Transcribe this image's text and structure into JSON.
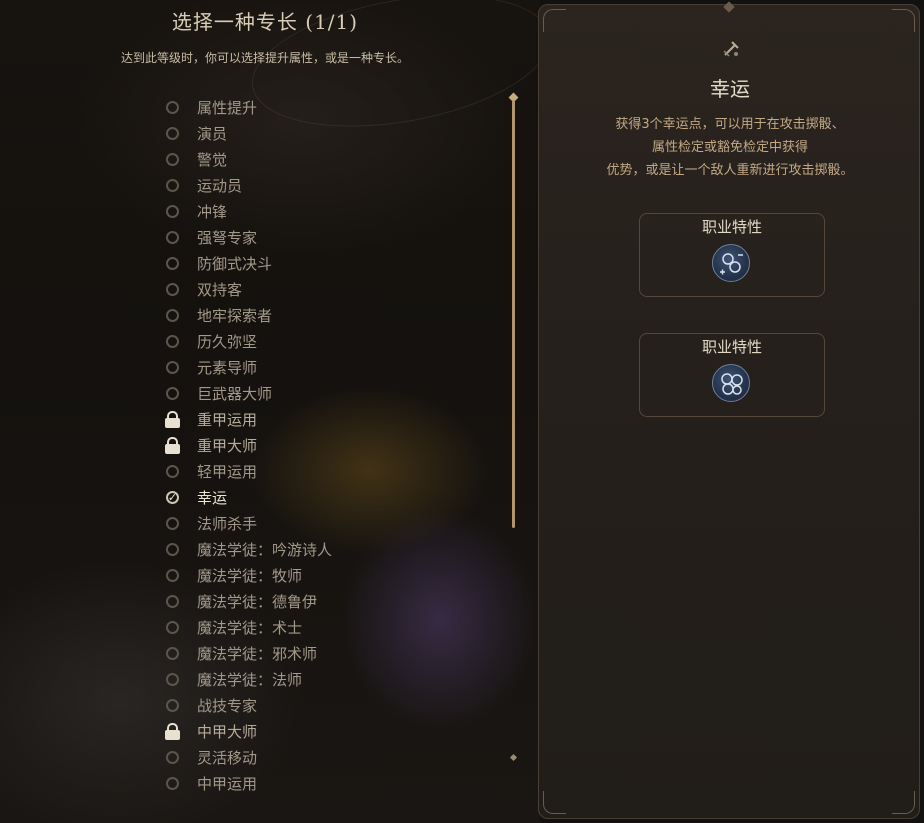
{
  "header": {
    "title": "选择一种专长 (1/1)",
    "subtitle": "达到此等级时，你可以选择提升属性，或是一种专长。"
  },
  "feat_list": [
    {
      "label": "属性提升",
      "state": "available"
    },
    {
      "label": "演员",
      "state": "available"
    },
    {
      "label": "警觉",
      "state": "available"
    },
    {
      "label": "运动员",
      "state": "available"
    },
    {
      "label": "冲锋",
      "state": "available"
    },
    {
      "label": "强弩专家",
      "state": "available"
    },
    {
      "label": "防御式决斗",
      "state": "available"
    },
    {
      "label": "双持客",
      "state": "available"
    },
    {
      "label": "地牢探索者",
      "state": "available"
    },
    {
      "label": "历久弥坚",
      "state": "available"
    },
    {
      "label": "元素导师",
      "state": "available"
    },
    {
      "label": "巨武器大师",
      "state": "available"
    },
    {
      "label": "重甲运用",
      "state": "locked"
    },
    {
      "label": "重甲大师",
      "state": "locked"
    },
    {
      "label": "轻甲运用",
      "state": "available"
    },
    {
      "label": "幸运",
      "state": "selected"
    },
    {
      "label": "法师杀手",
      "state": "available"
    },
    {
      "label": "魔法学徒：吟游诗人",
      "state": "available"
    },
    {
      "label": "魔法学徒：牧师",
      "state": "available"
    },
    {
      "label": "魔法学徒：德鲁伊",
      "state": "available"
    },
    {
      "label": "魔法学徒：术士",
      "state": "available"
    },
    {
      "label": "魔法学徒：邪术师",
      "state": "available"
    },
    {
      "label": "魔法学徒：法师",
      "state": "available"
    },
    {
      "label": "战技专家",
      "state": "available"
    },
    {
      "label": "中甲大师",
      "state": "locked"
    },
    {
      "label": "灵活移动",
      "state": "available"
    },
    {
      "label": "中甲运用",
      "state": "available"
    }
  ],
  "detail": {
    "icon": "dagger-scales-icon",
    "name": "幸运",
    "description_lines": [
      "获得3个幸运点，可以用于在攻击掷骰、",
      "属性检定或豁免检定中获得",
      "优势，或是让一个敌人重新进行攻击掷骰。"
    ],
    "cards": [
      {
        "label": "职业特性",
        "icon": "dice-plus-minus-icon"
      },
      {
        "label": "职业特性",
        "icon": "dice-cluster-icon"
      }
    ]
  },
  "colors": {
    "accent_gold": "#b2956c",
    "text_light": "#ece3d2",
    "text_muted": "#a3998a",
    "badge_blue": "#3f5577"
  }
}
